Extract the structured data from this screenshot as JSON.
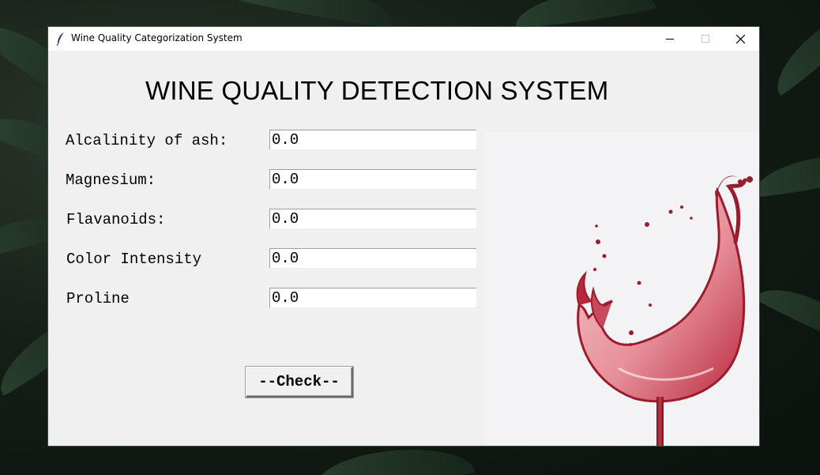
{
  "window": {
    "title": "Wine Quality Categorization System"
  },
  "heading": "WINE QUALITY DETECTION SYSTEM",
  "fields": [
    {
      "label": "Alcalinity of ash:",
      "value": "0.0"
    },
    {
      "label": "Magnesium:",
      "value": "0.0"
    },
    {
      "label": "Flavanoids:",
      "value": "0.0"
    },
    {
      "label": "Color Intensity",
      "value": "0.0"
    },
    {
      "label": "Proline",
      "value": "0.0"
    }
  ],
  "check_button": "--Check--",
  "icons": {
    "app": "feather-icon",
    "minimize": "minimize-icon",
    "maximize": "maximize-icon",
    "close": "close-icon"
  },
  "colors": {
    "wine": "#9b1c2c",
    "wine_light": "#e9a2a8",
    "window_bg": "#f0f0f0"
  }
}
